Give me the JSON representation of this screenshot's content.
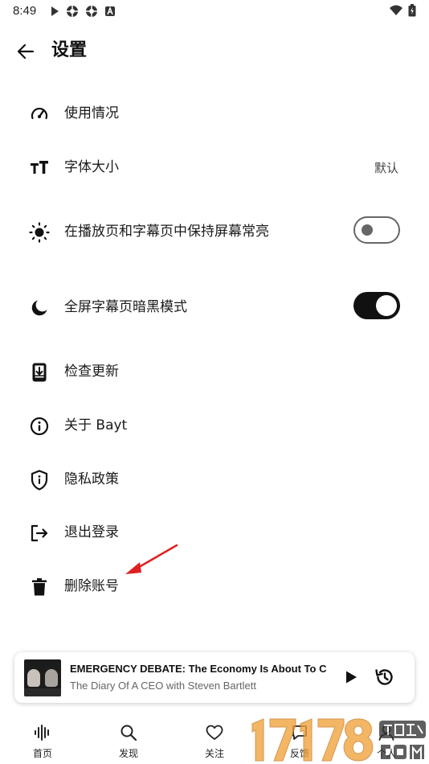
{
  "status_bar": {
    "time": "8:49"
  },
  "header": {
    "title": "设置"
  },
  "settings": {
    "usage": {
      "label": "使用情况"
    },
    "font_size": {
      "label": "字体大小",
      "value": "默认"
    },
    "keep_screen_on": {
      "label": "在播放页和字幕页中保持屏幕常亮",
      "state": "off"
    },
    "dark_mode": {
      "label": "全屏字幕页暗黑模式",
      "state": "on"
    },
    "check_update": {
      "label": "检查更新"
    },
    "about": {
      "label": "关于 Bayt"
    },
    "privacy": {
      "label": "隐私政策"
    },
    "logout": {
      "label": "退出登录"
    },
    "delete_account": {
      "label": "删除账号"
    }
  },
  "mini_player": {
    "title": "EMERGENCY DEBATE: The Economy Is About To C...",
    "subtitle": "The Diary Of A CEO with Steven Bartlett"
  },
  "bottom_nav": {
    "home": "首页",
    "discover": "发现",
    "follow": "关注",
    "feedback": "反馈",
    "me": "个人"
  },
  "colors": {
    "accent": "#111111",
    "annotation_arrow": "#e02020",
    "toggle_off": "#666666"
  }
}
